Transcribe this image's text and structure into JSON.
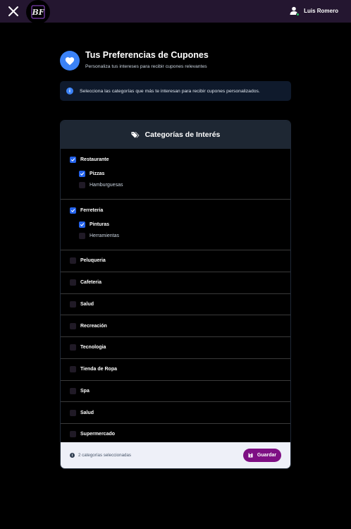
{
  "topbar": {
    "user_name": "Luis Romero",
    "logo_text": "BF"
  },
  "header": {
    "title": "Tus Preferencias de Cupones",
    "subtitle": "Personaliza tus intereses para recibir cupones relevantes",
    "info": "Selecciona las categorías que más te interesan para recibir cupones personalizados."
  },
  "card": {
    "title": "Categorías de Interés",
    "groups": [
      {
        "label": "Restaurante",
        "checked": true,
        "children": [
          {
            "label": "Pizzas",
            "checked": true
          },
          {
            "label": "Hamburguesas",
            "checked": false
          }
        ]
      },
      {
        "label": "Ferreteria",
        "checked": true,
        "children": [
          {
            "label": "Pinturas",
            "checked": true
          },
          {
            "label": "Herramientas",
            "checked": false
          }
        ]
      }
    ],
    "items": [
      {
        "label": "Peluqueria",
        "checked": false
      },
      {
        "label": "Cafeteria",
        "checked": false
      },
      {
        "label": "Salud",
        "checked": false
      },
      {
        "label": "Recreación",
        "checked": false
      },
      {
        "label": "Tecnologia",
        "checked": false
      },
      {
        "label": "Tienda de Ropa",
        "checked": false
      },
      {
        "label": "Spa",
        "checked": false
      },
      {
        "label": "Salud",
        "checked": false
      },
      {
        "label": "Supermercado",
        "checked": false
      }
    ],
    "footer": {
      "count_text": "2 categorías seleccionadas",
      "save_label": "Guardar"
    }
  },
  "colors": {
    "accent": "#3b82f6",
    "checkbox": "#2563eb",
    "save": "#7e0f84",
    "topbar": "#241630"
  }
}
